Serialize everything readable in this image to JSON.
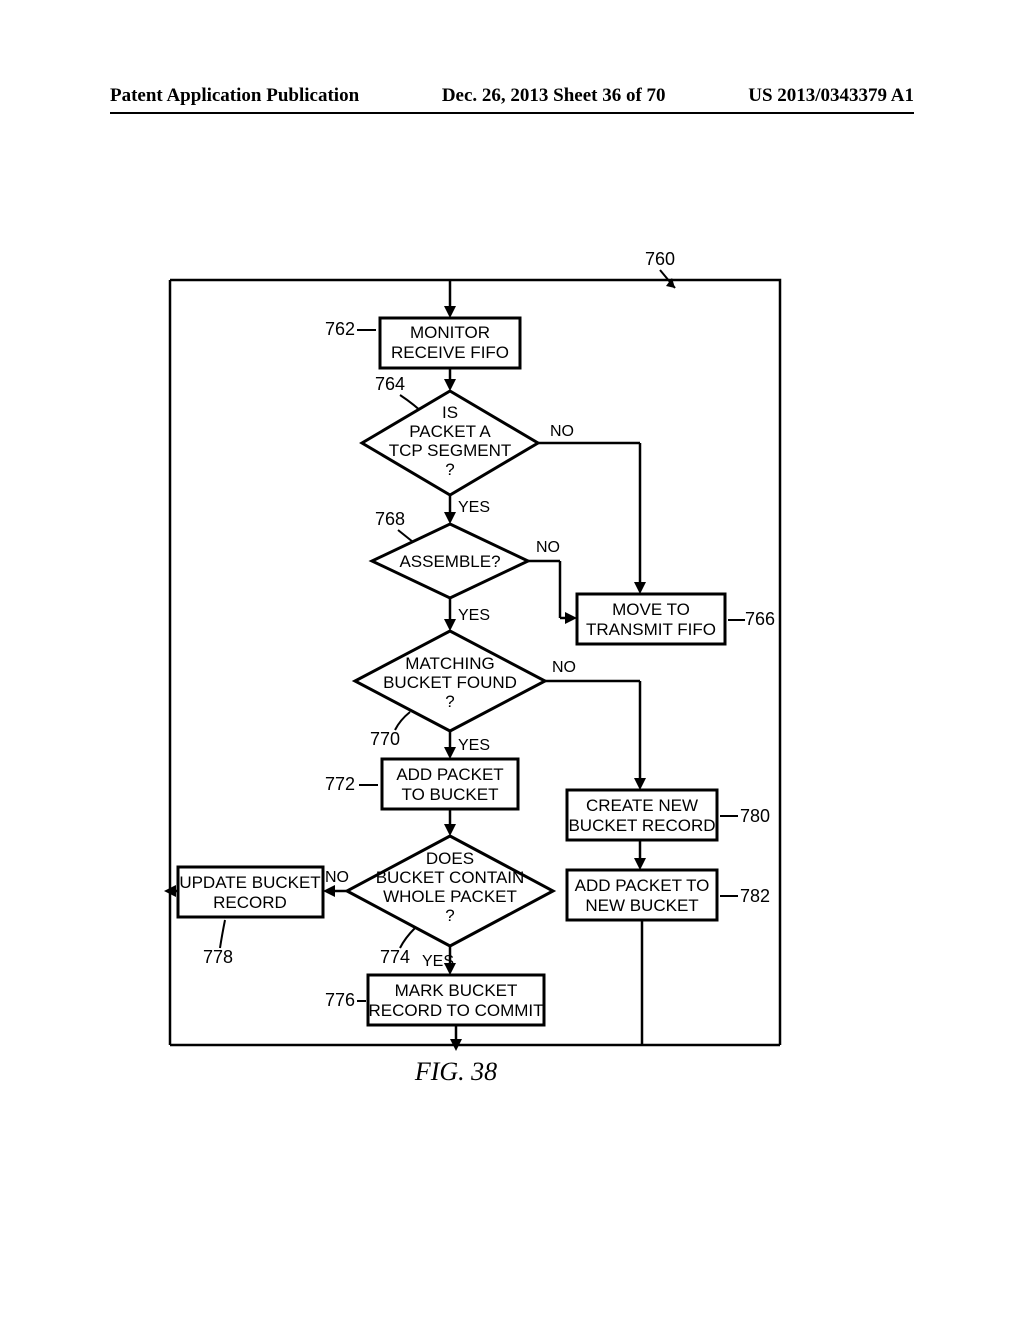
{
  "header": {
    "left": "Patent Application Publication",
    "center": "Dec. 26, 2013  Sheet 36 of 70",
    "right": "US 2013/0343379 A1"
  },
  "figure_label": "FIG. 38",
  "refs": {
    "r760": "760",
    "r762": "762",
    "r764": "764",
    "r766": "766",
    "r768": "768",
    "r770": "770",
    "r772": "772",
    "r774": "774",
    "r776": "776",
    "r778": "778",
    "r780": "780",
    "r782": "782"
  },
  "boxes": {
    "monitor_l1": "MONITOR",
    "monitor_l2": "RECEIVE FIFO",
    "tcp_l1": "IS",
    "tcp_l2": "PACKET A",
    "tcp_l3": "TCP SEGMENT",
    "tcp_l4": "?",
    "assemble": "ASSEMBLE?",
    "move_l1": "MOVE TO",
    "move_l2": "TRANSMIT FIFO",
    "match_l1": "MATCHING",
    "match_l2": "BUCKET FOUND",
    "match_l3": "?",
    "add_l1": "ADD PACKET",
    "add_l2": "TO BUCKET",
    "create_l1": "CREATE NEW",
    "create_l2": "BUCKET RECORD",
    "contain_l1": "DOES",
    "contain_l2": "BUCKET CONTAIN",
    "contain_l3": "WHOLE PACKET",
    "contain_l4": "?",
    "update_l1": "UPDATE BUCKET",
    "update_l2": "RECORD",
    "addnew_l1": "ADD PACKET TO",
    "addnew_l2": "NEW BUCKET",
    "mark_l1": "MARK BUCKET",
    "mark_l2": "RECORD TO COMMIT"
  },
  "edges": {
    "yes": "YES",
    "no": "NO"
  }
}
